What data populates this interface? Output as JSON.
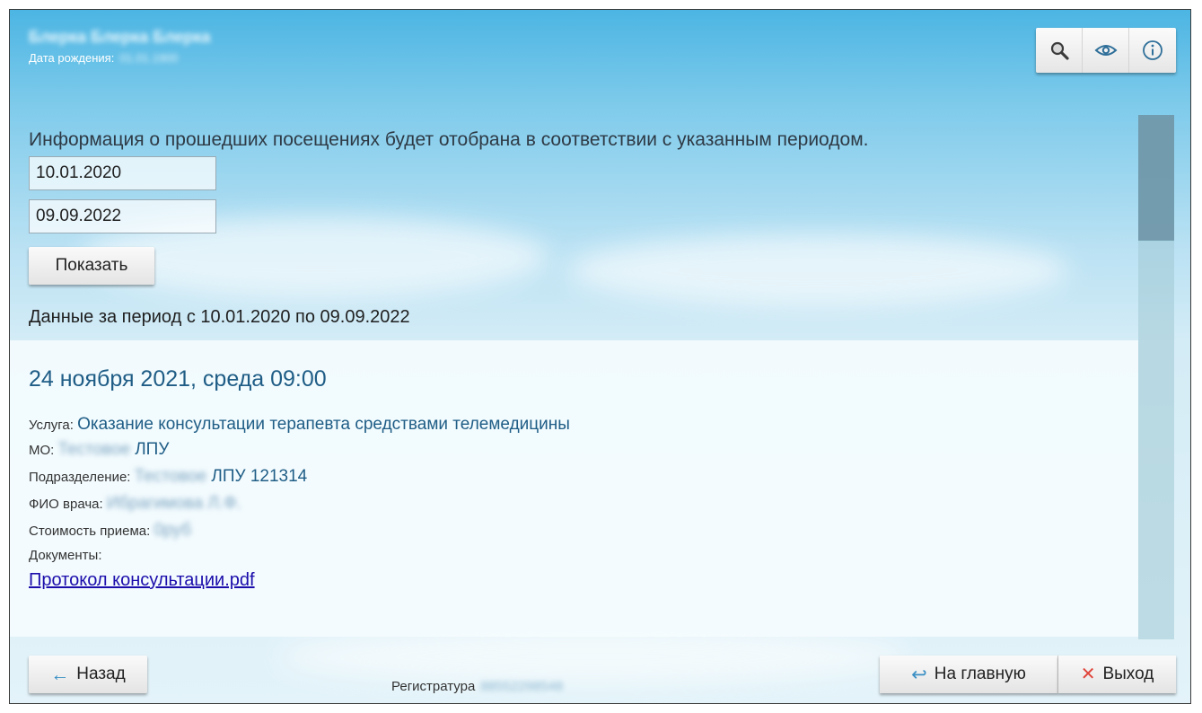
{
  "header": {
    "patient_name": "Блерка Блерка Блерка",
    "birth_label": "Дата рождения:",
    "birth_value": "01.01.1900"
  },
  "toolbar": {
    "icons": [
      "zoom-search-icon",
      "eye-icon",
      "info-icon"
    ]
  },
  "filter": {
    "intro": "Информация о прошедших посещениях будет отобрана в соответствии с указанным периодом.",
    "date_from": "10.01.2020",
    "date_to": "09.09.2022",
    "show_label": "Показать",
    "period_line": "Данные за период с 10.01.2020 по 09.09.2022"
  },
  "visit": {
    "datetime": "24 ноября 2021, среда 09:00",
    "service_label": "Услуга:",
    "service_value": "Оказание консультации терапевта средствами телемедицины",
    "mo_label": "МО:",
    "mo_value_hidden": "Тестовое",
    "mo_value": "ЛПУ",
    "subdivision_label": "Подразделение:",
    "subdivision_value_hidden": "Тестовое",
    "subdivision_value": "ЛПУ 121314",
    "doctor_label": "ФИО врача:",
    "doctor_value_hidden": "Ибрагимова Л.Ф.",
    "cost_label": "Стоимость приема:",
    "cost_value_hidden": "0руб",
    "documents_label": "Документы:",
    "document_link": "Протокол консультации.pdf"
  },
  "footer": {
    "back_label": "Назад",
    "home_label": "На главную",
    "exit_label": "Выход",
    "registry_label": "Регистратура",
    "registry_value_hidden": "88552298548"
  },
  "colors": {
    "accent_text": "#1f5d86",
    "link": "#1a0dab",
    "exit_x": "#e0443a",
    "arrow": "#3a8fc4"
  }
}
